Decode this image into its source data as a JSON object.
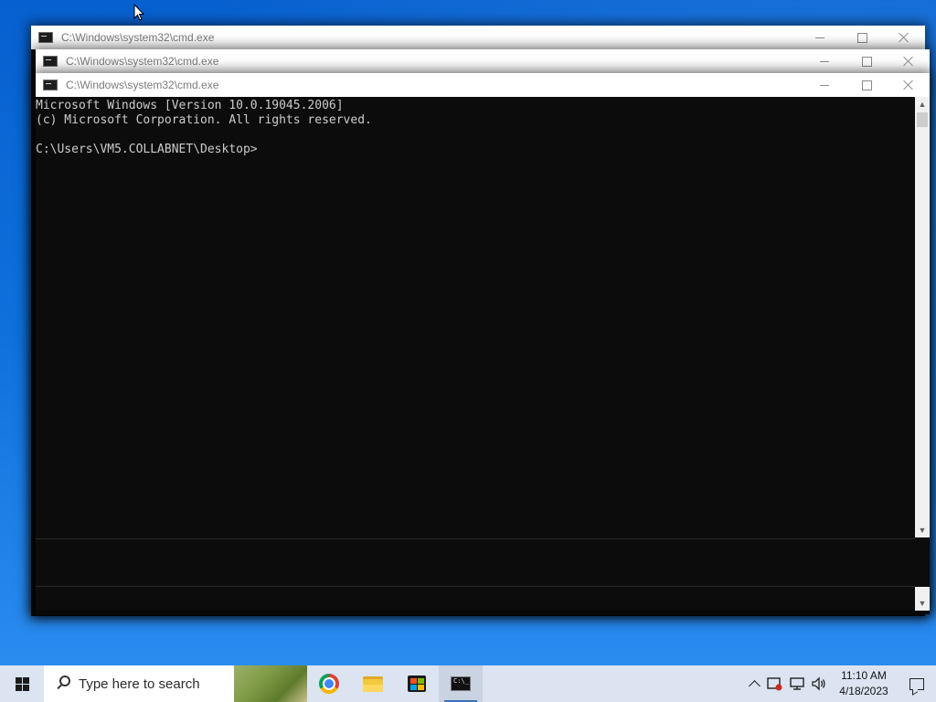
{
  "desktop": {
    "windows": [
      {
        "title": "C:\\Windows\\system32\\cmd.exe"
      },
      {
        "title": "C:\\Windows\\system32\\cmd.exe"
      },
      {
        "title": "C:\\Windows\\system32\\cmd.exe"
      }
    ]
  },
  "console": {
    "lines": [
      "Microsoft Windows [Version 10.0.19045.2006]",
      "(c) Microsoft Corporation. All rights reserved.",
      "",
      "C:\\Users\\VM5.COLLABNET\\Desktop>"
    ]
  },
  "taskbar": {
    "search_placeholder": "Type here to search",
    "pinned": [
      "chrome-icon",
      "file-explorer-icon",
      "microsoft-store-icon",
      "cmd-icon"
    ],
    "clock_time": "11:10 AM",
    "clock_date": "4/18/2023"
  },
  "colors": {
    "console_bg": "#0c0c0c",
    "console_fg": "#cccccc",
    "taskbar_bg": "#dbe4f0",
    "desktop_blue": "#0f70dc"
  }
}
